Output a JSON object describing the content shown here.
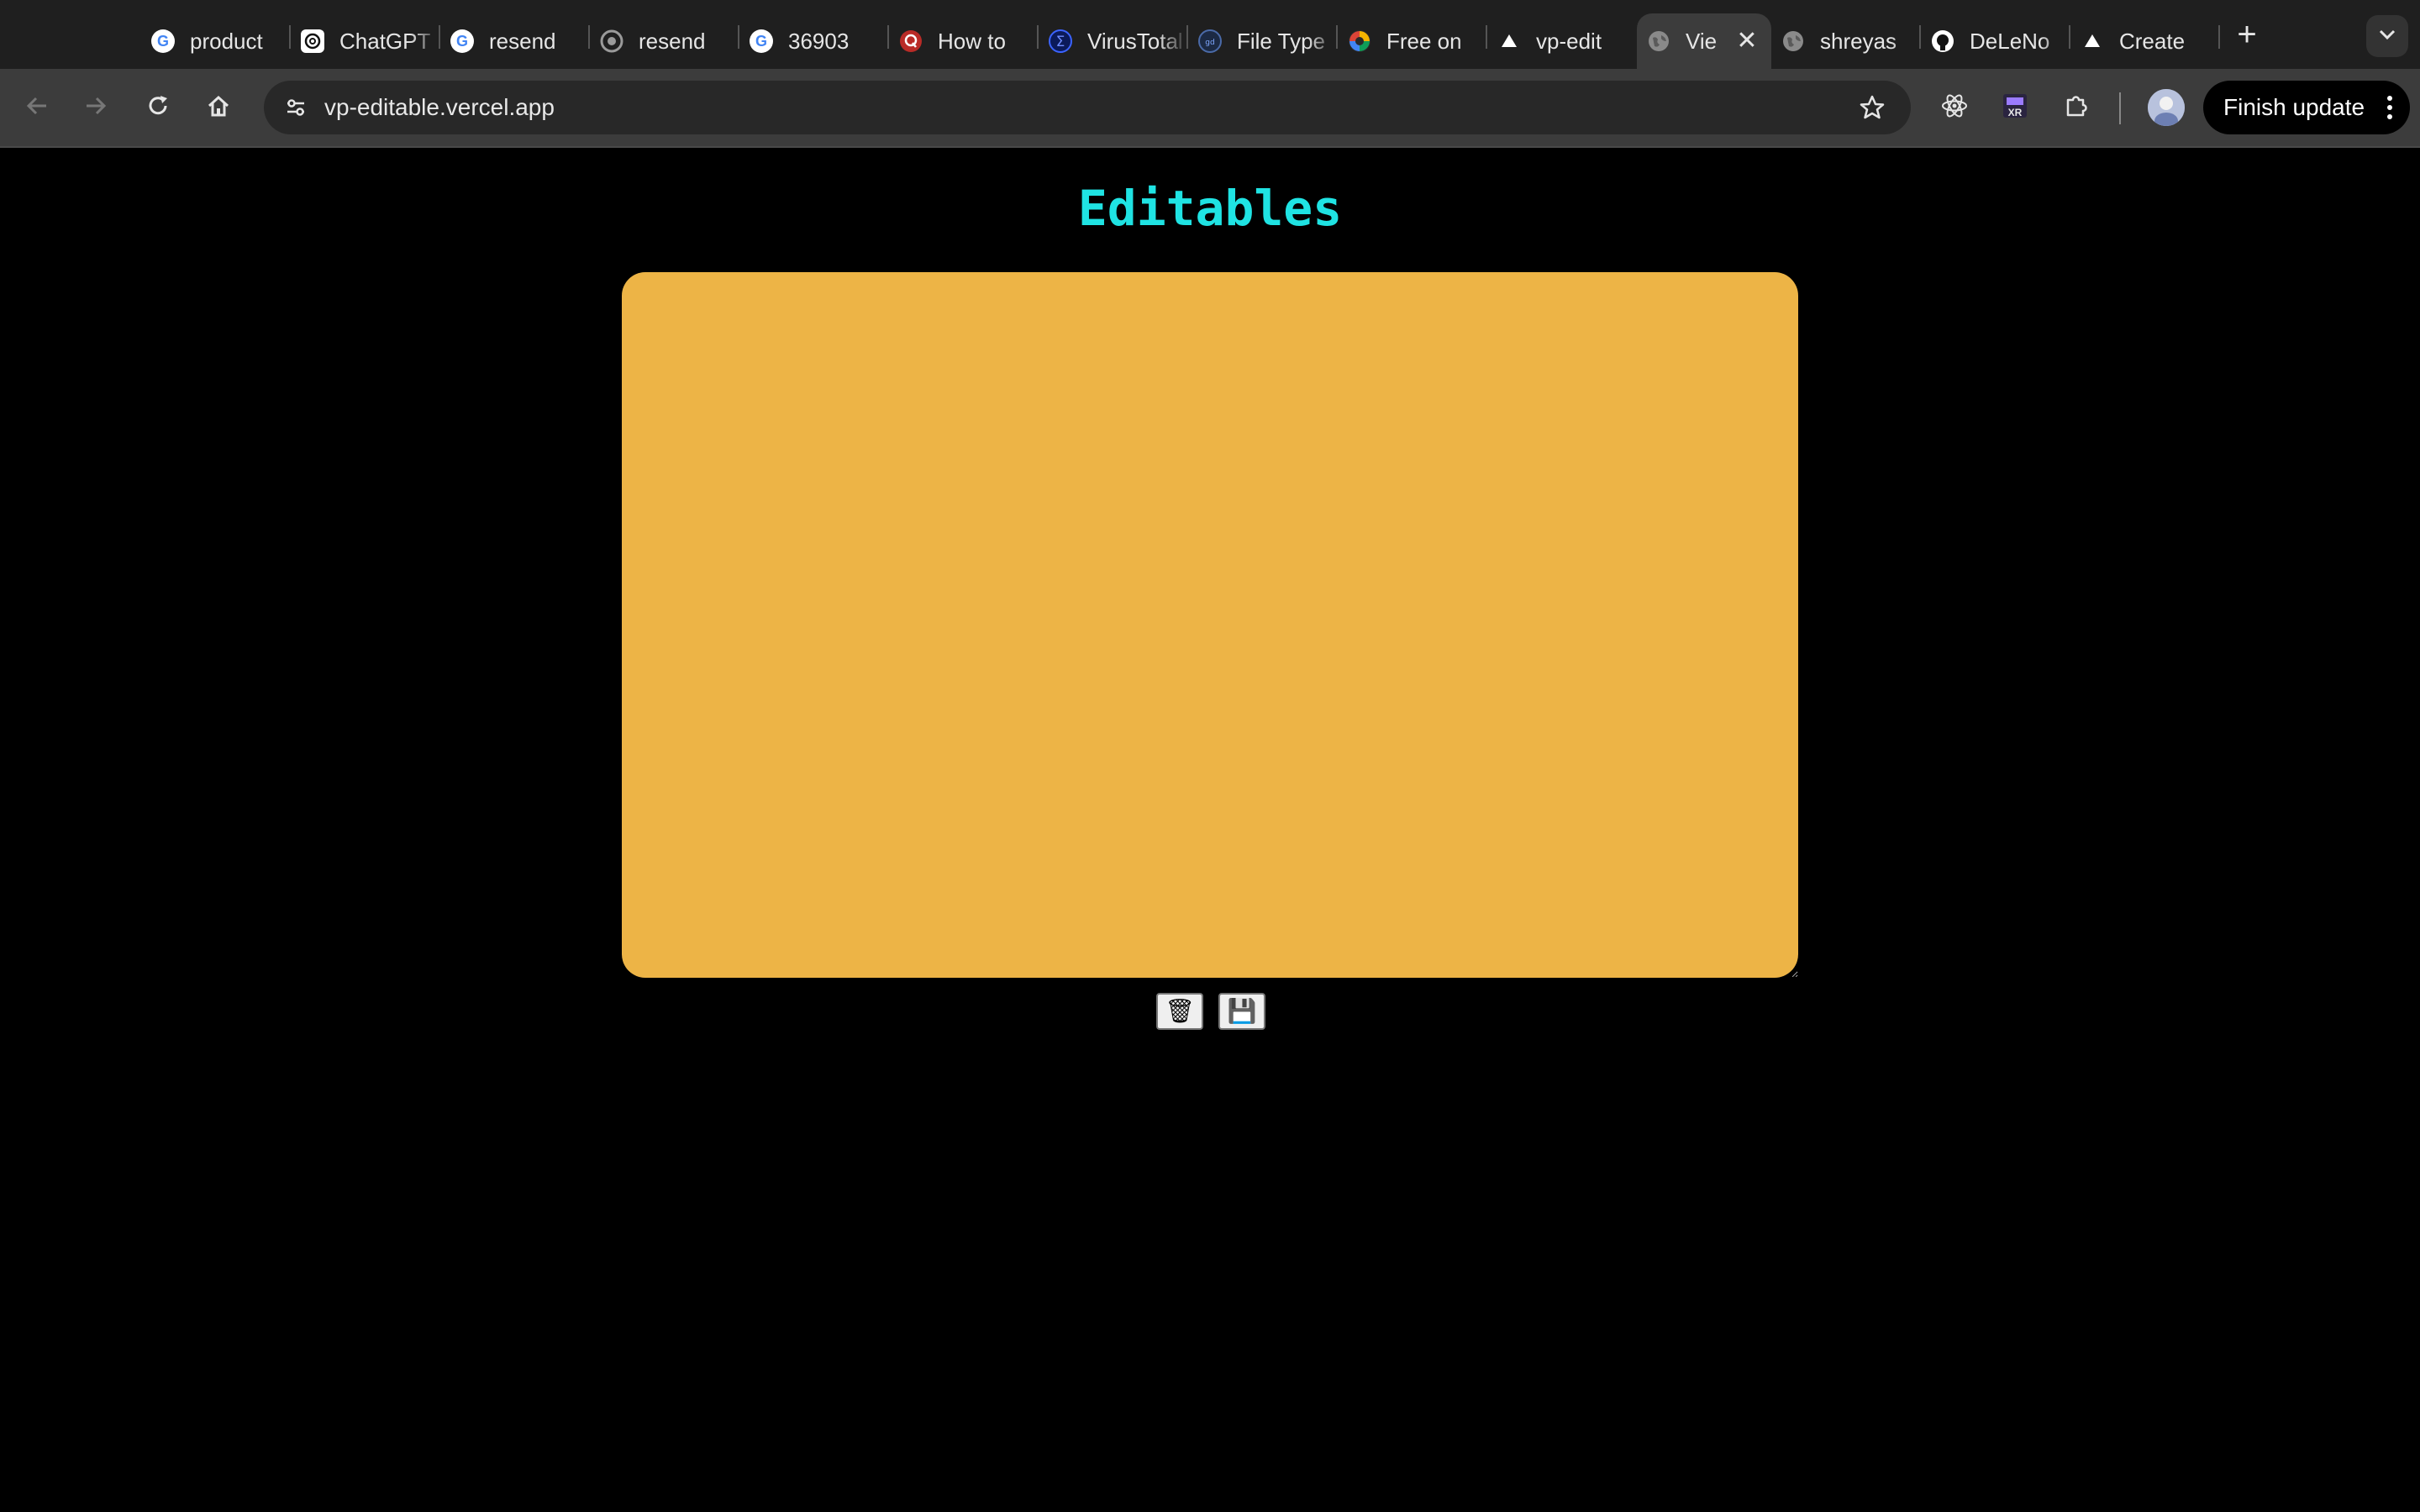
{
  "browser": {
    "tabs": [
      {
        "title": "product",
        "icon": "google-icon"
      },
      {
        "title": "ChatGPT",
        "icon": "chatgpt-icon"
      },
      {
        "title": "resend",
        "icon": "google-icon"
      },
      {
        "title": "resend",
        "icon": "loading-icon"
      },
      {
        "title": "36903",
        "icon": "google-icon"
      },
      {
        "title": "How to",
        "icon": "quora-icon"
      },
      {
        "title": "VirusTotal",
        "icon": "virustotal-icon"
      },
      {
        "title": "File Type",
        "icon": "filetype-icon"
      },
      {
        "title": "Free on",
        "icon": "colorful-icon"
      },
      {
        "title": "vp-edit",
        "icon": "vercel-icon"
      },
      {
        "title": "Vie",
        "icon": "globe-icon",
        "active": true
      },
      {
        "title": "shreyas",
        "icon": "globe-icon"
      },
      {
        "title": "DeLeNo",
        "icon": "github-icon"
      },
      {
        "title": "Create",
        "icon": "vercel-icon"
      }
    ],
    "new_tab_label": "+",
    "address_bar": {
      "url": "vp-editable.vercel.app"
    },
    "finish_update_label": "Finish update"
  },
  "page": {
    "title": "Editables",
    "note": {
      "text": "",
      "background_color": "#edb446"
    },
    "actions": {
      "delete_icon": "🗑",
      "save_icon": "💾"
    }
  },
  "colors": {
    "title_color": "#1fe3e3",
    "page_background": "#000000",
    "tabstrip": "#1f1f1f",
    "toolbar": "#3c3c3c"
  }
}
